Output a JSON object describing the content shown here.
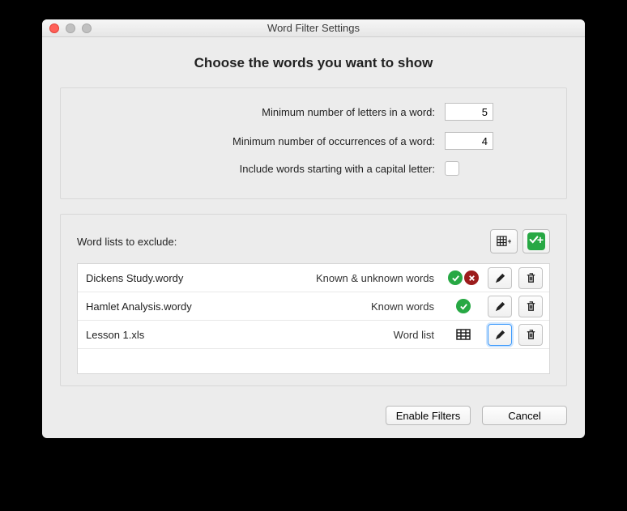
{
  "window": {
    "title": "Word Filter Settings"
  },
  "heading": "Choose the words you want to show",
  "form": {
    "min_letters_label": "Minimum number of letters in a word:",
    "min_letters_value": "5",
    "min_occurrences_label": "Minimum number of occurrences of a word:",
    "min_occurrences_value": "4",
    "include_capital_label": "Include words starting with a capital letter:",
    "include_capital_checked": false
  },
  "exclude": {
    "label": "Word lists to exclude:",
    "rows": [
      {
        "file": "Dickens Study.wordy",
        "type": "Known & unknown words",
        "status": "green-red"
      },
      {
        "file": "Hamlet Analysis.wordy",
        "type": "Known words",
        "status": "green"
      },
      {
        "file": "Lesson 1.xls",
        "type": "Word list",
        "status": "grid"
      }
    ]
  },
  "footer": {
    "enable": "Enable Filters",
    "cancel": "Cancel"
  }
}
